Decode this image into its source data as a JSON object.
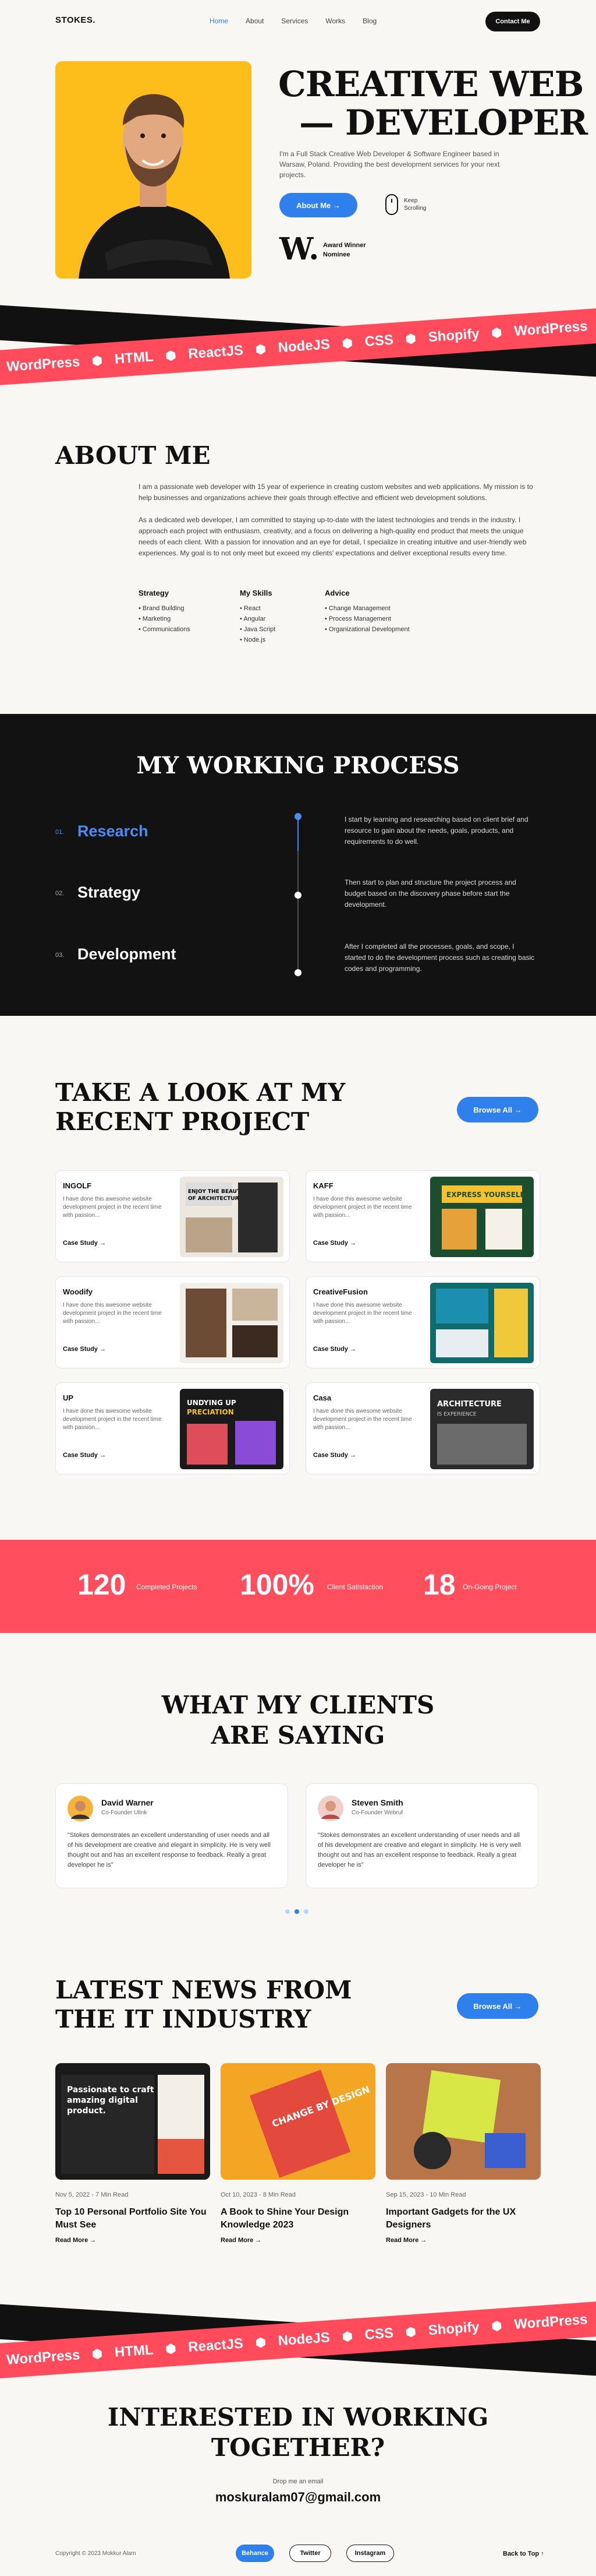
{
  "nav": {
    "logo": "STOKES.",
    "links": [
      "Home",
      "About",
      "Services",
      "Works",
      "Blog"
    ],
    "contact": "Contact Me"
  },
  "hero": {
    "title_line1": "CREATIVE WEB",
    "title_line2": "— DEVELOPER",
    "description": "I'm a Full Stack Creative Web Developer & Software Engineer based in Warsaw, Poland. Providing the best development services for your next projects.",
    "button": "About Me →",
    "scroll_line1": "Keep",
    "scroll_line2": "Scrolling",
    "award_letter": "W.",
    "award_line1": "Award Winner",
    "award_line2": "Nominee"
  },
  "ribbon": {
    "items": [
      "WordPress",
      "HTML",
      "ReactJS",
      "NodeJS",
      "CSS",
      "Shopify",
      "WordPress",
      "HTML",
      "ReactJS"
    ]
  },
  "about": {
    "title": "ABOUT ME",
    "p1": "I am a passionate web developer with 15 year of experience in creating custom websites and web applications. My mission is to help businesses and organizations achieve their goals through effective and efficient web development solutions.",
    "p2": "As a dedicated web developer, I am committed to staying up-to-date with the latest technologies and trends in the industry. I approach each project with enthusiasm, creativity, and a focus on delivering a high-quality end product that meets the unique needs of each client. With a passion for innovation and an eye for detail, I specialize in creating intuitive and user-friendly web experiences. My goal is to not only meet but exceed my clients' expectations and deliver exceptional results every time.",
    "columns": [
      {
        "heading": "Strategy",
        "items": [
          "Brand Building",
          "Marketing",
          "Communications"
        ]
      },
      {
        "heading": "My Skills",
        "items": [
          "React",
          "Angular",
          "Java Script",
          "Node.js"
        ]
      },
      {
        "heading": "Advice",
        "items": [
          "Change Management",
          "Process Management",
          "Organizational Development"
        ]
      }
    ]
  },
  "process": {
    "title": "MY WORKING PROCESS",
    "steps": [
      {
        "num": "01.",
        "name": "Research",
        "desc": "I start by learning and researching based on client brief and resource to gain about the needs, goals, products, and requirements to do well."
      },
      {
        "num": "02.",
        "name": "Strategy",
        "desc": "Then start to plan and structure the project process and budget based on the discovery phase before start the development."
      },
      {
        "num": "03.",
        "name": "Development",
        "desc": "After I completed all the processes, goals, and scope, I started to do the development process such as creating basic codes and programming."
      }
    ]
  },
  "projects": {
    "title_line1": "TAKE A LOOK AT MY",
    "title_line2": "RECENT PROJECT",
    "browse": "Browse All →",
    "cards": [
      {
        "title": "INGOLF",
        "desc": "I have done this awesome website development project in the recent time with passion...",
        "link": "Case Study →"
      },
      {
        "title": "KAFF",
        "desc": "I have done this awesome website development project in the recent time with passion...",
        "link": "Case Study →"
      },
      {
        "title": "Woodify",
        "desc": "I have done this awesome website development project in the recent time with passion...",
        "link": "Case Study →"
      },
      {
        "title": "CreativeFusion",
        "desc": "I have done this awesome website development project in the recent time with passion...",
        "link": "Case Study →"
      },
      {
        "title": "UP",
        "desc": "I have done this awesome website development project in the recent time with passion...",
        "link": "Case Study →"
      },
      {
        "title": "Casa",
        "desc": "I have done this awesome website development project in the recent time with passion...",
        "link": "Case Study →"
      }
    ]
  },
  "stats": [
    {
      "value": "120",
      "label": "Completed Projects"
    },
    {
      "value": "100%",
      "label": "Client Satisfaction"
    },
    {
      "value": "18",
      "label": "On-Going Project"
    }
  ],
  "testimonials": {
    "title_line1": "WHAT MY CLIENTS",
    "title_line2": "ARE SAYING",
    "items": [
      {
        "name": "David Warner",
        "role": "Co-Founder Ulink",
        "quote": "\"Stokes demonstrates an excellent understanding of user needs and all of his development are creative and elegant in simplicity. He is very well thought out and has an excellent response to feedback. Really a great developer he is\""
      },
      {
        "name": "Steven Smith",
        "role": "Co-Founder Webruf",
        "quote": "\"Stokes demonstrates an excellent understanding of user needs and all of his development are creative and elegant in simplicity. He is very well thought out and has an excellent response to feedback. Really a great developer he is\""
      }
    ]
  },
  "news": {
    "title_line1": "LATEST NEWS FROM",
    "title_line2": "THE  IT INDUSTRY",
    "browse": "Browse All →",
    "items": [
      {
        "meta": "Nov 5, 2022 - 7 Min Read",
        "title": "Top 10 Personal Portfolio Site You Must See",
        "more": "Read More →",
        "img_line1": "Passionate to craft",
        "img_line2": "amazing digital",
        "img_line3": "product."
      },
      {
        "meta": "Oct 10, 2023 - 8 Min Read",
        "title": "A Book to Shine Your Design Knowledge 2023",
        "more": "Read More →",
        "img_text": "CHANGE BY DESIGN"
      },
      {
        "meta": "Sep 15, 2023 - 10 Min Read",
        "title": "Important Gadgets for the UX Designers",
        "more": "Read More →"
      }
    ]
  },
  "cta": {
    "title_line1": "INTERESTED IN WORKING",
    "title_line2": "TOGETHER?",
    "sub": "Drop me an email",
    "email": "moskuralam07@gmail.com"
  },
  "footer": {
    "copyright": "Copyright © 2023 Mokkur Alam",
    "buttons": [
      "Behance",
      "Twitter",
      "Instagram"
    ],
    "top": "Back to Top ↑"
  },
  "colors": {
    "accent": "#2f80ed",
    "red": "#ff4b5c",
    "dark": "#121212",
    "hero_bg": "#fdbd1b"
  }
}
